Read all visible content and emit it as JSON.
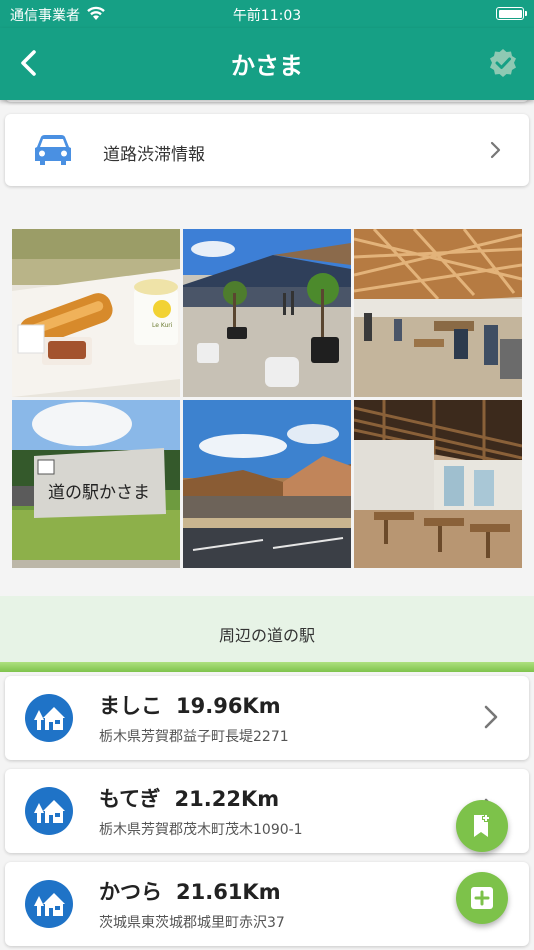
{
  "status_bar": {
    "carrier": "通信事業者",
    "time": "午前11:03"
  },
  "header": {
    "title": "かさま"
  },
  "traffic": {
    "label": "道路渋滞情報"
  },
  "section": {
    "nearby_title": "周辺の道の駅"
  },
  "stations": [
    {
      "name": "ましこ",
      "distance": "19.96Km",
      "address": "栃木県芳賀郡益子町長堤2271"
    },
    {
      "name": "もてぎ",
      "distance": "21.22Km",
      "address": "栃木県芳賀郡茂木町茂木1090-1"
    },
    {
      "name": "かつら",
      "distance": "21.61Km",
      "address": "茨城県東茨城郡城里町赤沢37"
    }
  ],
  "photos": {
    "sign_text": "道の駅かさま",
    "cup_text": "Le Kuri"
  },
  "colors": {
    "header": "#16a085",
    "accent_green": "#7dc24a",
    "station_icon_blue": "#1f73c7",
    "car_blue": "#4a90e2"
  },
  "icons": {
    "back": "chevron-left-icon",
    "verified": "verified-badge-icon",
    "car": "car-icon",
    "station": "roadside-station-icon",
    "bookmark_add": "bookmark-add-icon",
    "add": "add-box-icon"
  }
}
